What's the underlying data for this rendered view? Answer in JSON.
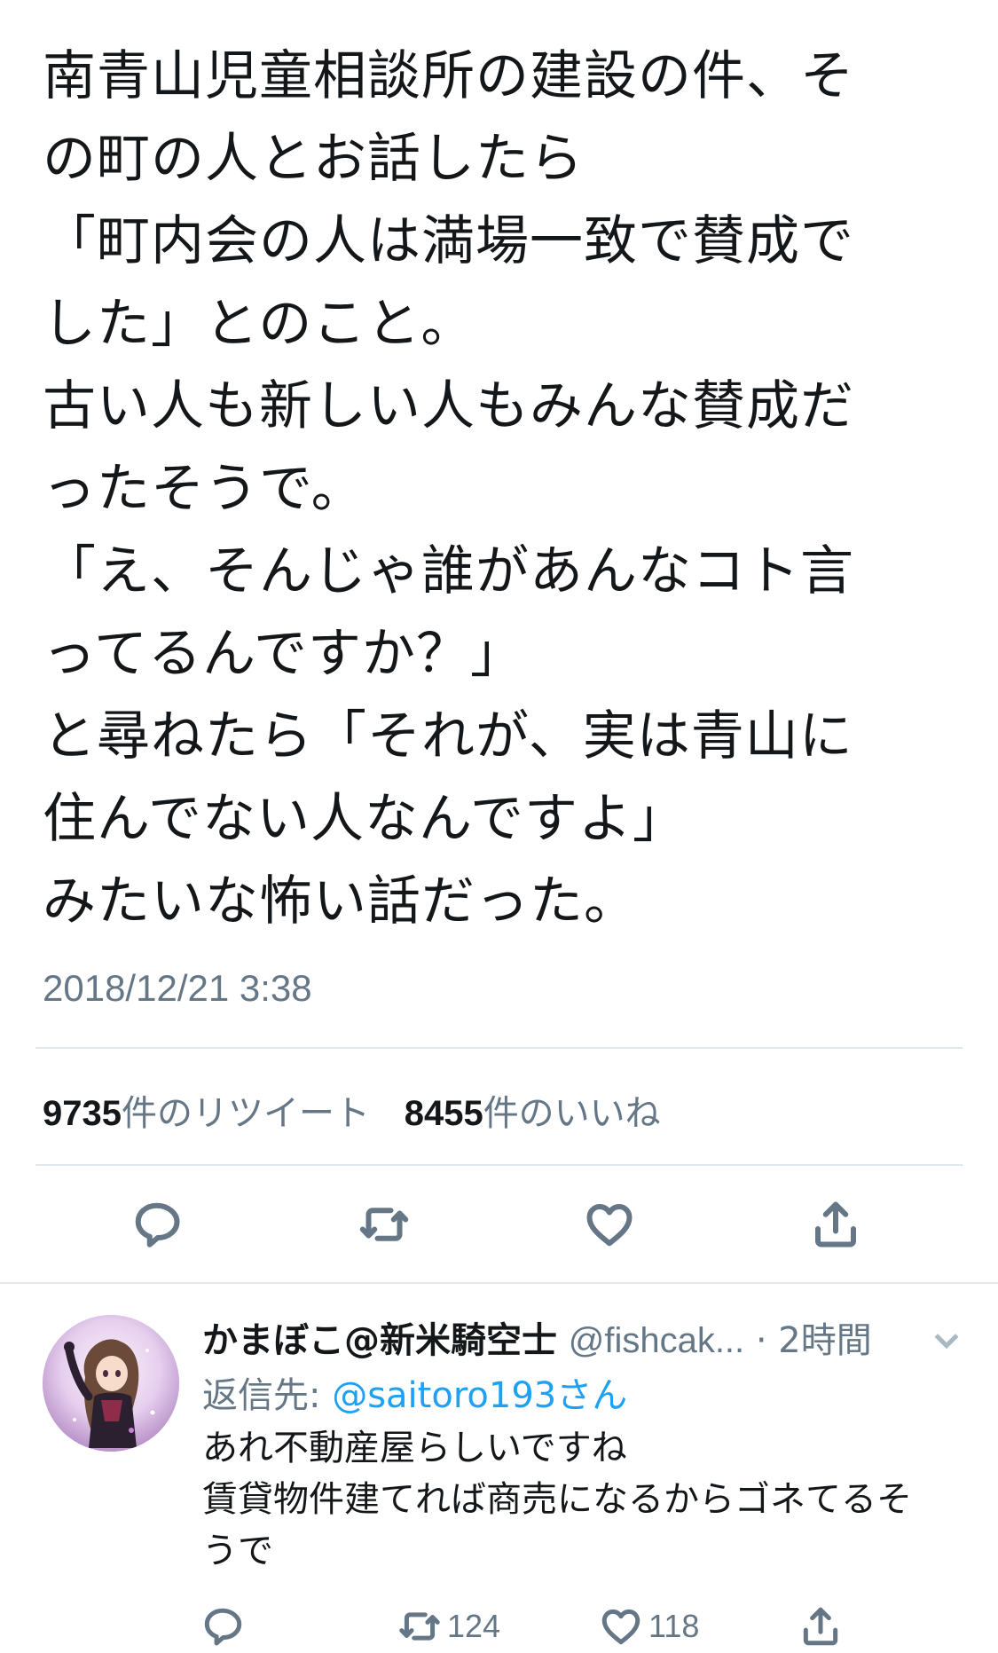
{
  "tweet": {
    "lines": [
      "南青山児童相談所の建設の件、そ",
      "の町の人とお話したら",
      "「町内会の人は満場一致で賛成で",
      "した」とのこと。",
      "古い人も新しい人もみんな賛成だ",
      "ったそうで。",
      "「え、そんじゃ誰があんなコト言",
      "ってるんですか？」",
      "と尋ねたら「それが、実は青山に",
      "住んでない人なんですよ」",
      "みたいな怖い話だった。"
    ],
    "timestamp": "2018/12/21 3:38",
    "retweet_count": "9735",
    "retweet_label": "件のリツイート",
    "like_count": "8455",
    "like_label": "件のいいね"
  },
  "actions": {
    "reply_icon": "reply-icon",
    "retweet_icon": "retweet-icon",
    "like_icon": "heart-icon",
    "share_icon": "share-icon"
  },
  "reply": {
    "display_name": "かまぼこ@新米騎空士",
    "handle": "@fishcak...",
    "time": "· 2時間",
    "reply_to_prefix": "返信先: ",
    "reply_to_mention": "@saitoro193さん",
    "lines": [
      "あれ不動産屋らしいですね",
      "賃貸物件建てれば商売になるからゴネてるそ",
      "うで"
    ],
    "retweet_count": "124",
    "like_count": "118"
  },
  "colors": {
    "text": "#14171a",
    "secondary": "#657786",
    "link": "#1da1f2",
    "divider": "#e1e8ed"
  }
}
